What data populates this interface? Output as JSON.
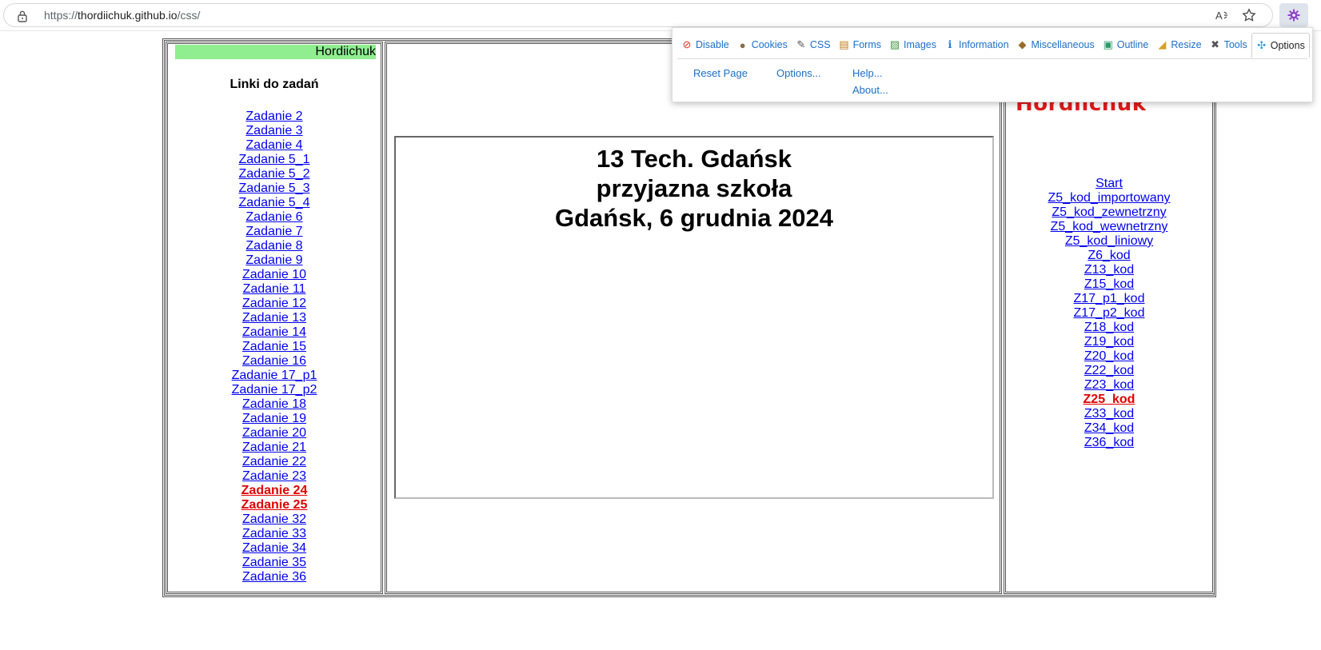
{
  "browser": {
    "url_prefix": "https://",
    "url_host": "thordiichuk.github.io",
    "url_path": "/css/"
  },
  "extension": {
    "tabs": [
      {
        "label": "Disable",
        "icon": "disable-icon",
        "glyph": "⊘"
      },
      {
        "label": "Cookies",
        "icon": "cookies-icon",
        "glyph": "●"
      },
      {
        "label": "CSS",
        "icon": "css-icon",
        "glyph": "✎"
      },
      {
        "label": "Forms",
        "icon": "forms-icon",
        "glyph": "▤"
      },
      {
        "label": "Images",
        "icon": "images-icon",
        "glyph": "▨"
      },
      {
        "label": "Information",
        "icon": "information-icon",
        "glyph": "ℹ"
      },
      {
        "label": "Miscellaneous",
        "icon": "miscellaneous-icon",
        "glyph": "◆"
      },
      {
        "label": "Outline",
        "icon": "outline-icon",
        "glyph": "▣"
      },
      {
        "label": "Resize",
        "icon": "resize-icon",
        "glyph": "◢"
      },
      {
        "label": "Tools",
        "icon": "tools-icon",
        "glyph": "✖"
      },
      {
        "label": "Options",
        "icon": "options-icon",
        "glyph": "✣",
        "active": true
      }
    ],
    "menu_col1": [
      "Reset Page"
    ],
    "menu_col2": [
      "Options..."
    ],
    "menu_col3": [
      "Help...",
      "About..."
    ]
  },
  "left": {
    "banner": "Hordiichuk",
    "heading": "Linki do zadań",
    "links": [
      {
        "label": "Zadanie 2"
      },
      {
        "label": "Zadanie 3"
      },
      {
        "label": "Zadanie 4"
      },
      {
        "label": "Zadanie 5_1"
      },
      {
        "label": "Zadanie 5_2"
      },
      {
        "label": "Zadanie 5_3"
      },
      {
        "label": "Zadanie 5_4"
      },
      {
        "label": "Zadanie 6"
      },
      {
        "label": "Zadanie 7"
      },
      {
        "label": "Zadanie 8"
      },
      {
        "label": "Zadanie 9"
      },
      {
        "label": "Zadanie 10"
      },
      {
        "label": "Zadanie 11"
      },
      {
        "label": "Zadanie 12"
      },
      {
        "label": "Zadanie 13"
      },
      {
        "label": "Zadanie 14"
      },
      {
        "label": "Zadanie 15"
      },
      {
        "label": "Zadanie 16"
      },
      {
        "label": "Zadanie 17_p1"
      },
      {
        "label": "Zadanie 17_p2"
      },
      {
        "label": "Zadanie 18"
      },
      {
        "label": "Zadanie 19"
      },
      {
        "label": "Zadanie 20"
      },
      {
        "label": "Zadanie 21"
      },
      {
        "label": "Zadanie 22"
      },
      {
        "label": "Zadanie 23"
      },
      {
        "label": "Zadanie 24",
        "highlight": true
      },
      {
        "label": "Zadanie 25",
        "highlight": true
      },
      {
        "label": "Zadanie 32"
      },
      {
        "label": "Zadanie 33"
      },
      {
        "label": "Zadanie 34"
      },
      {
        "label": "Zadanie 35"
      },
      {
        "label": "Zadanie 36"
      }
    ]
  },
  "middle": {
    "line1": "13 Tech. Gdańsk",
    "line2": "przyjazna szkoła",
    "line3": "Gdańsk, 6 grudnia 2024"
  },
  "right": {
    "title": "Hordiichuk",
    "links": [
      {
        "label": "Start"
      },
      {
        "label": "Z5_kod_importowany"
      },
      {
        "label": "Z5_kod_zewnetrzny"
      },
      {
        "label": "Z5_kod_wewnetrzny"
      },
      {
        "label": "Z5_kod_liniowy"
      },
      {
        "label": "Z6_kod"
      },
      {
        "label": "Z13_kod"
      },
      {
        "label": "Z15_kod"
      },
      {
        "label": "Z17_p1_kod"
      },
      {
        "label": "Z17_p2_kod"
      },
      {
        "label": "Z18_kod"
      },
      {
        "label": "Z19_kod"
      },
      {
        "label": "Z20_kod"
      },
      {
        "label": "Z22_kod"
      },
      {
        "label": "Z23_kod"
      },
      {
        "label": "Z25_kod",
        "highlight": true
      },
      {
        "label": "Z33_kod"
      },
      {
        "label": "Z34_kod"
      },
      {
        "label": "Z36_kod"
      }
    ]
  },
  "colors": {
    "link": "#0000ee",
    "link_highlight": "#e00000",
    "banner_bg": "#90ee90",
    "right_title": "#e21a1a",
    "extension_link": "#1a6fc9"
  }
}
